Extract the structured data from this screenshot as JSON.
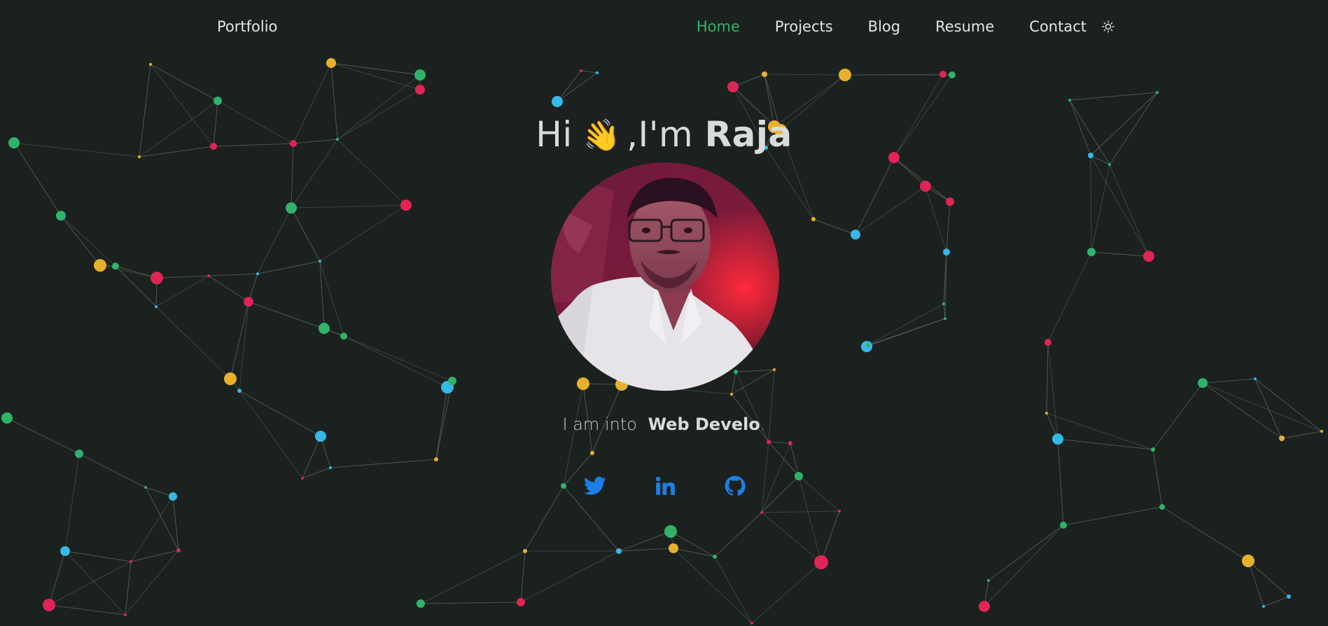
{
  "nav": {
    "brand": "Portfolio",
    "items": [
      {
        "label": "Home",
        "active": true
      },
      {
        "label": "Projects",
        "active": false
      },
      {
        "label": "Blog",
        "active": false
      },
      {
        "label": "Resume",
        "active": false
      },
      {
        "label": "Contact",
        "active": false
      }
    ],
    "theme_icon": "sun-icon"
  },
  "hero": {
    "greeting_prefix": "Hi",
    "wave_emoji": "👋",
    "greeting_middle": ",I'm",
    "name": "Raja",
    "tagline_prefix": "I am into",
    "tagline_typed": "Web Develo",
    "tagline_suffix": "."
  },
  "socials": [
    {
      "icon": "twitter-icon"
    },
    {
      "icon": "linkedin-icon"
    },
    {
      "icon": "github-icon"
    }
  ],
  "colors": {
    "background": "#1b211e",
    "accent": "#2fb36b",
    "social": "#1d7fe6",
    "particles": [
      "#2fb36b",
      "#e8b12b",
      "#e02456",
      "#35b9e8"
    ]
  }
}
